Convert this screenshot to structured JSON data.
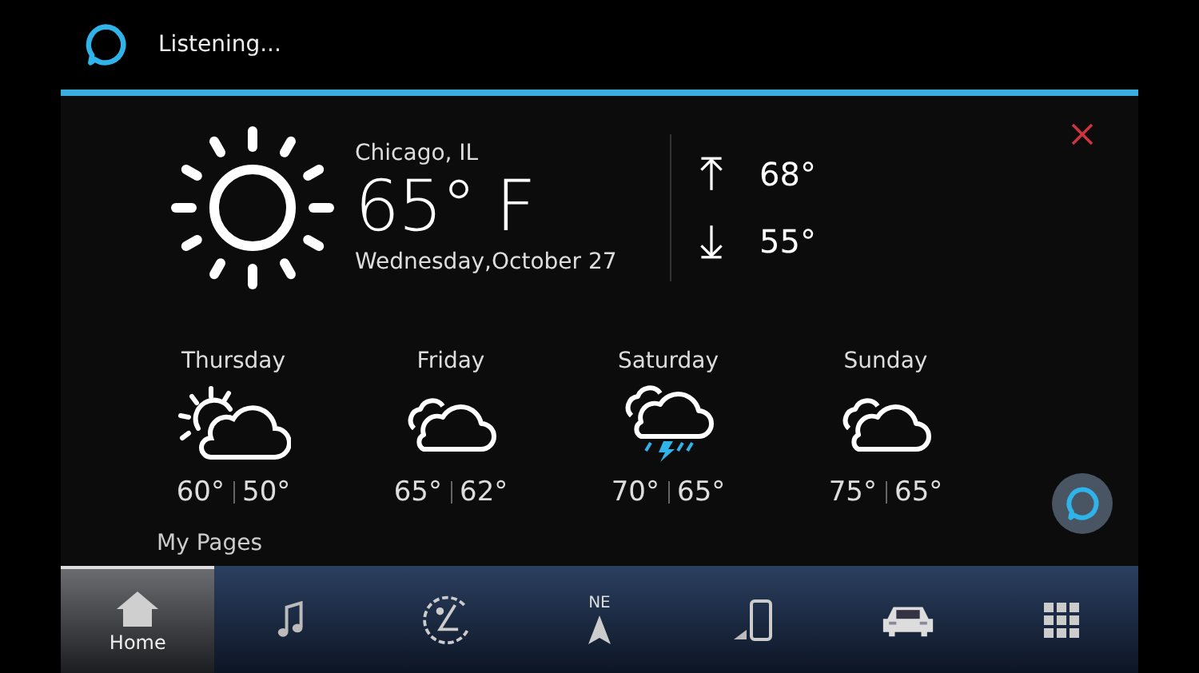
{
  "status": {
    "text": "Listening..."
  },
  "current": {
    "location": "Chicago, IL",
    "temperature": "65° F",
    "date": "Wednesday,October 27",
    "high": "68°",
    "low": "55°"
  },
  "forecast": [
    {
      "day": "Thursday",
      "kind": "partly-sunny",
      "high": "60°",
      "low": "50°"
    },
    {
      "day": "Friday",
      "kind": "cloudy",
      "high": "65°",
      "low": "62°"
    },
    {
      "day": "Saturday",
      "kind": "storm",
      "high": "70°",
      "low": "65°"
    },
    {
      "day": "Sunday",
      "kind": "cloudy",
      "high": "75°",
      "low": "65°"
    }
  ],
  "section_label": "My Pages",
  "nav": [
    {
      "kind": "home",
      "label": "Home",
      "selected": true
    },
    {
      "kind": "music",
      "selected": false
    },
    {
      "kind": "seat",
      "selected": false
    },
    {
      "kind": "compass",
      "label": "NE",
      "selected": false
    },
    {
      "kind": "phone",
      "selected": false
    },
    {
      "kind": "car",
      "selected": false
    },
    {
      "kind": "apps",
      "selected": false
    }
  ]
}
